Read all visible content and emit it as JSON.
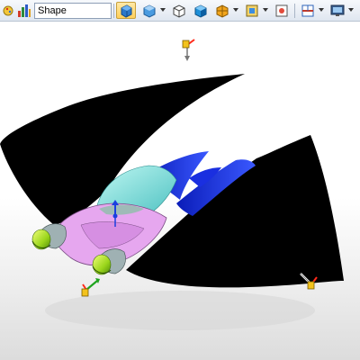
{
  "toolbar": {
    "shape_value": "Shape",
    "buttons": [
      {
        "name": "palette-icon"
      },
      {
        "name": "bar-chart-icon"
      },
      {
        "name": "shape-combo"
      },
      {
        "name": "view-orientation-icon"
      },
      {
        "name": "display-style-icon"
      },
      {
        "name": "iso-cube-icon"
      },
      {
        "name": "shaded-cube-icon"
      },
      {
        "name": "section-view-icon"
      },
      {
        "name": "zoom-fit-icon"
      },
      {
        "name": "hide-show-icon"
      },
      {
        "name": "split-view-icon"
      },
      {
        "name": "monitor-icon"
      }
    ]
  },
  "colors": {
    "toolbar_bg": "#e4eaf2",
    "active_button": "#ffd35c",
    "shell_black": "#000000",
    "canopy_cyan": "#7fe6df",
    "fin_blue": "#1426d6",
    "fuselage_pink": "#e8a6f0",
    "engine_green": "#c8f03a",
    "engine_gray": "#9fb1b3",
    "triad_red": "#ff2a1a"
  }
}
